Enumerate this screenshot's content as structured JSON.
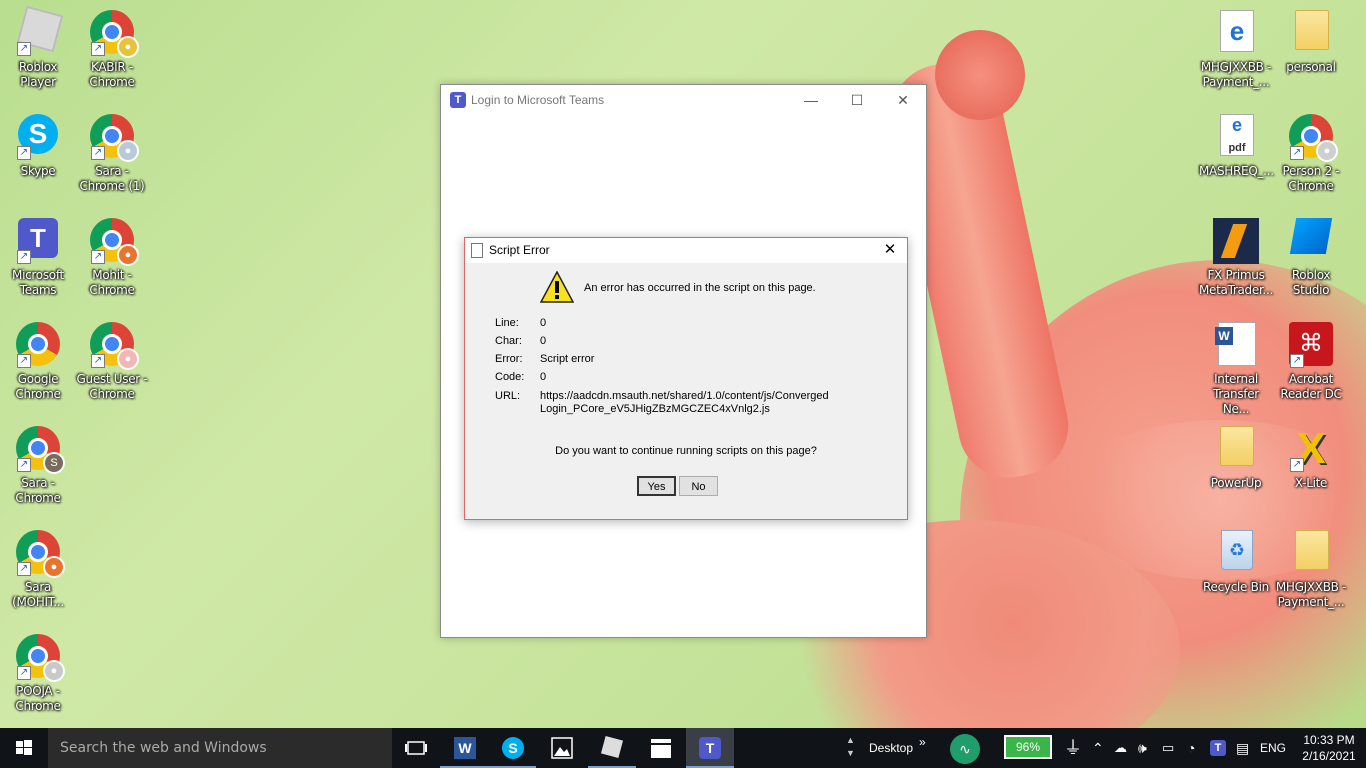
{
  "desktop_icons": {
    "left_col1": [
      {
        "label": "Roblox Player"
      },
      {
        "label": "Skype"
      },
      {
        "label": "Microsoft Teams"
      },
      {
        "label": "Google Chrome"
      },
      {
        "label": "Sara - Chrome"
      },
      {
        "label": "Sara (MOHIT..."
      },
      {
        "label": "POOJA - Chrome"
      }
    ],
    "left_col2": [
      {
        "label": "KABIR - Chrome"
      },
      {
        "label": "Sara - Chrome (1)"
      },
      {
        "label": "Mohit - Chrome"
      },
      {
        "label": "Guest User - Chrome"
      }
    ],
    "right_col1": [
      {
        "label": "MHGJXXBB - Payment_..."
      },
      {
        "label": "MASHREQ_..."
      },
      {
        "label": "FX Primus MetaTrader..."
      },
      {
        "label": "Internal Transfer Ne..."
      },
      {
        "label": "PowerUp"
      },
      {
        "label": "Recycle Bin"
      }
    ],
    "right_col2": [
      {
        "label": "personal"
      },
      {
        "label": "Person 2 - Chrome"
      },
      {
        "label": "Roblox Studio"
      },
      {
        "label": "Acrobat Reader DC"
      },
      {
        "label": "X-Lite"
      },
      {
        "label": "MHGJXXBB - Payment_..."
      }
    ]
  },
  "teams_window": {
    "title": "Login to Microsoft Teams",
    "minimize": "—",
    "maximize": "☐",
    "close": "✕"
  },
  "script_error": {
    "title": "Script Error",
    "close": "✕",
    "message": "An error has occurred in the script on this page.",
    "rows": [
      {
        "key": "Line:",
        "value": "0"
      },
      {
        "key": "Char:",
        "value": "0"
      },
      {
        "key": "Error:",
        "value": "Script error"
      },
      {
        "key": "Code:",
        "value": "0"
      },
      {
        "key": "URL:",
        "value": "https://aadcdn.msauth.net/shared/1.0/content/js/ConvergedLogin_PCore_eV5JHigZBzMGCZEC4xVnlg2.js"
      }
    ],
    "url_line1": "https://aadcdn.msauth.net/shared/1.0/content/js/Converged",
    "url_line2": "Login_PCore_eV5JHigZBzMGCZEC4xVnlg2.js",
    "question": "Do you want to continue running scripts on this page?",
    "yes_label": "Yes",
    "no_label": "No"
  },
  "taskbar": {
    "search_placeholder": "Search the web and Windows",
    "desktop_label": "Desktop",
    "desktop_chevron": "»",
    "battery": "96%",
    "language": "ENG",
    "time": "10:33 PM",
    "date": "2/16/2021"
  },
  "colors": {
    "taskbar": "#101418",
    "dialog_border": "#e06666",
    "accent": "#5059c9"
  }
}
